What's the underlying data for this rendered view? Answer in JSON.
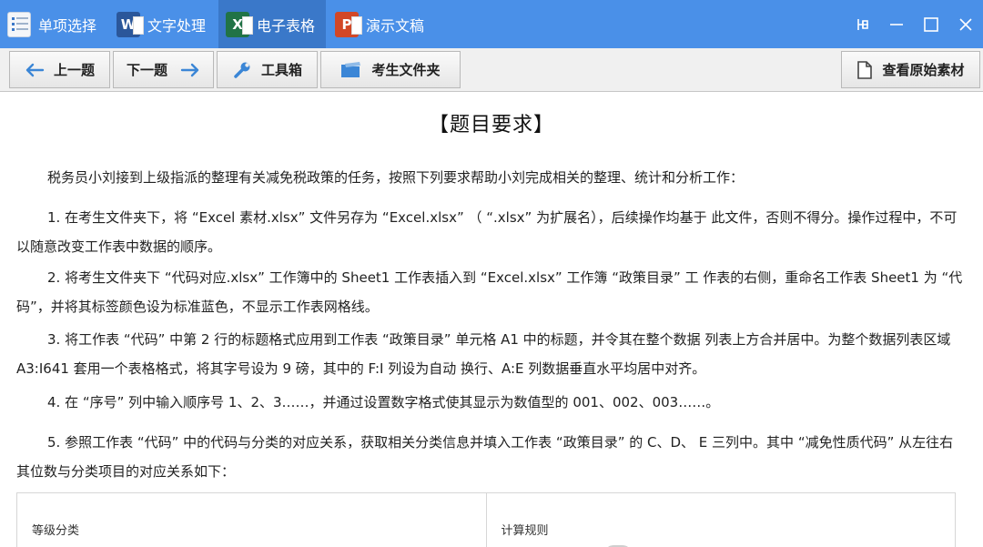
{
  "titlebar": {
    "tabs": [
      {
        "label": "单项选择",
        "icon": "list-icon",
        "active": false
      },
      {
        "label": "文字处理",
        "icon": "word-icon",
        "active": false
      },
      {
        "label": "电子表格",
        "icon": "excel-icon",
        "active": true
      },
      {
        "label": "演示文稿",
        "icon": "powerpoint-icon",
        "active": false
      }
    ],
    "icon_letters": {
      "word": "W",
      "excel": "X",
      "ppt": "P"
    },
    "controls": [
      "pin-icon",
      "minimize-icon",
      "maximize-icon",
      "close-icon"
    ],
    "colors": {
      "bar": "#4a90e8",
      "active_tab": "#3a78c9"
    }
  },
  "toolbar": {
    "prev": "上一题",
    "next": "下一题",
    "tools": "工具箱",
    "folder": "考生文件夹",
    "view_source": "查看原始素材"
  },
  "content": {
    "heading": "【题目要求】",
    "paragraphs": [
      "税务员小刘接到上级指派的整理有关减免税政策的任务，按照下列要求帮助小刘完成相关的整理、统计和分析工作：",
      "1. 在考生文件夹下，将 “Excel 素材.xlsx” 文件另存为 “Excel.xlsx” （ “.xlsx” 为扩展名），后续操作均基于 此文件，否则不得分。操作过程中，不可以随意改变工作表中数据的顺序。",
      "2. 将考生文件夹下 “代码对应.xlsx” 工作簿中的 Sheet1 工作表插入到 “Excel.xlsx” 工作簿 “政策目录” 工 作表的右侧，重命名工作表 Sheet1 为 “代码”，并将其标签颜色设为标准蓝色，不显示工作表网格线。",
      "3. 将工作表 “代码” 中第 2 行的标题格式应用到工作表 “政策目录” 单元格 A1 中的标题，并令其在整个数据 列表上方合并居中。为整个数据列表区域 A3:I641 套用一个表格格式，将其字号设为 9 磅，其中的 F:I 列设为自动 换行、A:E 列数据垂直水平均居中对齐。",
      "4. 在 “序号” 列中输入顺序号 1、2、3……，并通过设置数字格式使其显示为数值型的 001、002、003……。",
      "5. 参照工作表 “代码” 中的代码与分类的对应关系，获取相关分类信息并填入工作表 “政策目录” 的 C、D、 E 三列中。其中 “减免性质代码” 从左往右其位数与分类项目的对应关系如下："
    ],
    "table_headers": [
      "等级分类",
      "计算规则"
    ]
  }
}
